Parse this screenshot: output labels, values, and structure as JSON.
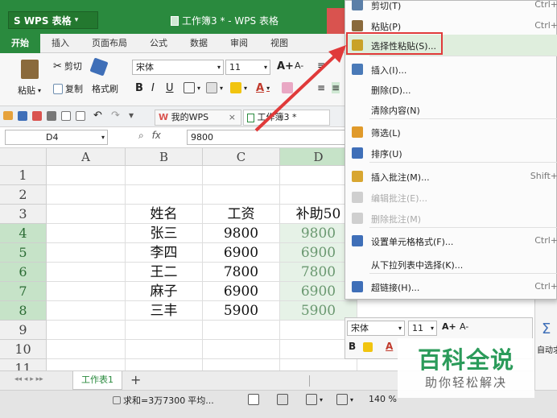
{
  "app": {
    "logo": "S WPS 表格",
    "doc_title": "工作簿3 * - WPS 表格"
  },
  "tabs": [
    "开始",
    "插入",
    "页面布局",
    "公式",
    "数据",
    "审阅",
    "视图"
  ],
  "ribbon": {
    "paste_label": "粘贴",
    "cut_label": "剪切",
    "copy_label": "复制",
    "format_painter_label": "格式刷",
    "font_name": "宋体",
    "font_size": "11",
    "bold": "B",
    "italic": "I",
    "underline": "U",
    "grow_font": "A+",
    "shrink_font": "A-"
  },
  "quickbar": {
    "wps_tab": "我的WPS",
    "doc_tab": "工作簿3 *"
  },
  "formula": {
    "cell_ref": "D4",
    "fx": "fx",
    "value": "9800"
  },
  "grid": {
    "columns": [
      "A",
      "B",
      "C",
      "D"
    ],
    "rows": [
      "1",
      "2",
      "3",
      "4",
      "5",
      "6",
      "7",
      "8",
      "9",
      "10",
      "11"
    ],
    "headers_row": {
      "B": "姓名",
      "C": "工资",
      "D": "补助50"
    },
    "data": [
      {
        "name": "张三",
        "salary": "9800",
        "bonus": "9800"
      },
      {
        "name": "李四",
        "salary": "6900",
        "bonus": "6900"
      },
      {
        "name": "王二",
        "salary": "7800",
        "bonus": "7800"
      },
      {
        "name": "麻子",
        "salary": "6900",
        "bonus": "6900"
      },
      {
        "name": "三丰",
        "salary": "5900",
        "bonus": "5900"
      }
    ]
  },
  "sheets": {
    "active": "工作表1",
    "add": "+"
  },
  "status": {
    "sum": "求和=3万7300",
    "avg": "平均...",
    "zoom": "140 %"
  },
  "context_menu": [
    {
      "label": "剪切(T)",
      "key": "Ctrl+",
      "icon": "scissors-icon",
      "state": "normal"
    },
    {
      "label": "粘贴(P)",
      "key": "Ctrl+",
      "icon": "paste-icon",
      "state": "normal"
    },
    {
      "label": "选择性粘贴(S)...",
      "key": "",
      "icon": "paste-special-icon",
      "state": "highlight"
    },
    {
      "label": "插入(I)...",
      "key": "",
      "icon": "insert-icon",
      "state": "normal"
    },
    {
      "label": "删除(D)...",
      "key": "",
      "icon": "",
      "state": "normal"
    },
    {
      "label": "清除内容(N)",
      "key": "",
      "icon": "",
      "state": "normal"
    },
    {
      "label": "筛选(L)",
      "key": "",
      "icon": "filter-icon",
      "state": "normal"
    },
    {
      "label": "排序(U)",
      "key": "",
      "icon": "sort-icon",
      "state": "normal"
    },
    {
      "label": "插入批注(M)...",
      "key": "Shift+",
      "icon": "comment-add-icon",
      "state": "normal"
    },
    {
      "label": "编辑批注(E)...",
      "key": "",
      "icon": "comment-edit-icon",
      "state": "disabled"
    },
    {
      "label": "删除批注(M)",
      "key": "",
      "icon": "comment-delete-icon",
      "state": "disabled"
    },
    {
      "label": "设置单元格格式(F)...",
      "key": "Ctrl+",
      "icon": "format-cells-icon",
      "state": "normal"
    },
    {
      "label": "从下拉列表中选择(K)...",
      "key": "",
      "icon": "",
      "state": "normal"
    },
    {
      "label": "超链接(H)...",
      "key": "Ctrl+",
      "icon": "hyperlink-icon",
      "state": "normal"
    }
  ],
  "mini_toolbar": {
    "font_name": "宋体",
    "font_size": "11",
    "bold": "B",
    "autosum": "自动求"
  },
  "watermark": {
    "title": "百科全说",
    "subtitle": "助你轻松解决"
  },
  "colors": {
    "brand_green": "#2a8a3e",
    "selection_fill": "#e6f2e7",
    "highlight_red": "#e03a3a"
  }
}
